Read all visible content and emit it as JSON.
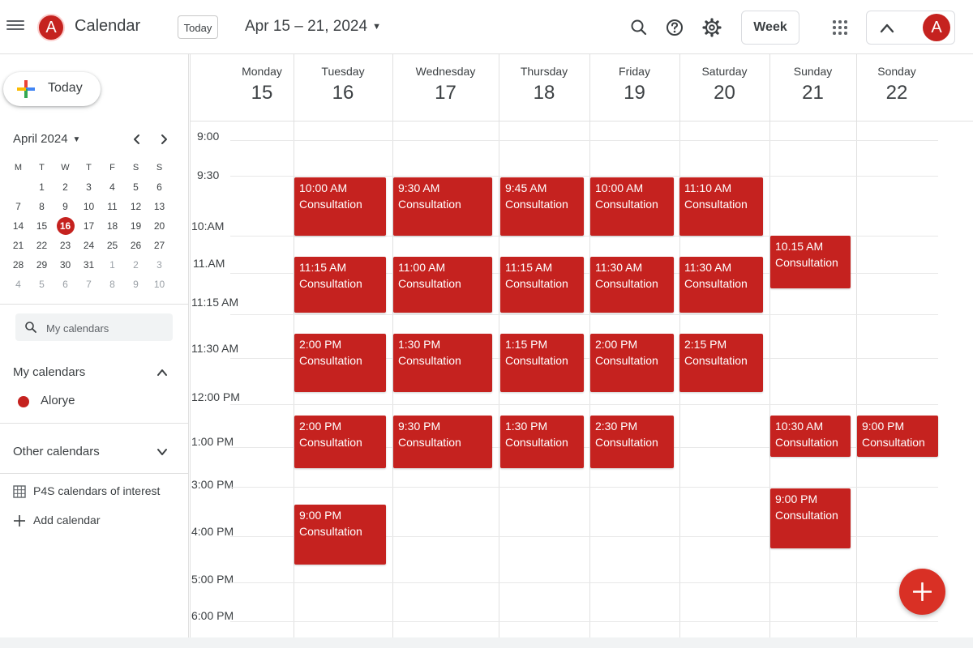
{
  "header": {
    "logo_letter": "A",
    "app_title": "Calendar",
    "today_button": "Today",
    "date_range": "Apr 15 – 21, 2024",
    "view_button": "Week",
    "avatar_letter": "A",
    "icons": [
      "menu-icon",
      "search-icon",
      "help-icon",
      "settings-icon",
      "apps-grid-icon",
      "chevron-up-icon",
      "dropdown-caret-icon"
    ]
  },
  "sidebar": {
    "create_button": "Today",
    "mini_calendar": {
      "month_label": "April 2024",
      "weekdays": [
        "M",
        "T",
        "W",
        "T",
        "F",
        "S",
        "S"
      ],
      "weeks": [
        [
          "",
          "1",
          "2",
          "3",
          "4",
          "5",
          "6"
        ],
        [
          "7",
          "8",
          "9",
          "10",
          "11",
          "12",
          "13"
        ],
        [
          "14",
          "15",
          "16",
          "17",
          "18",
          "19",
          "20"
        ],
        [
          "21",
          "22",
          "23",
          "24",
          "25",
          "26",
          "27"
        ],
        [
          "28",
          "29",
          "30",
          "31",
          "1",
          "2",
          "3"
        ],
        [
          "4",
          "5",
          "6",
          "7",
          "8",
          "9",
          "10"
        ]
      ],
      "selected_day": "16"
    },
    "search_placeholder": "My calendars",
    "my_calendars_title": "My calendars",
    "my_calendars": [
      {
        "label": "Alorye",
        "color": "#c5221f"
      }
    ],
    "other_calendars_title": "Other calendars",
    "other_calendars": [
      {
        "label": "P4S calendars of interest",
        "icon": "grid-calendar-icon"
      },
      {
        "label": "Add calendar",
        "icon": "plus-icon"
      }
    ]
  },
  "days": [
    {
      "name": "Monday",
      "num": "15"
    },
    {
      "name": "Tuesday",
      "num": "16"
    },
    {
      "name": "Wednesday",
      "num": "17"
    },
    {
      "name": "Thursday",
      "num": "18"
    },
    {
      "name": "Friday",
      "num": "19"
    },
    {
      "name": "Saturday",
      "num": "20"
    },
    {
      "name": "Sunday",
      "num": "21"
    },
    {
      "name": "Sonday",
      "num": "22"
    }
  ],
  "time_labels": [
    "9:00",
    "9:30",
    "10:AM",
    "11.AM",
    "11:15 AM",
    "11:30 AM",
    "12:00 PM",
    "1:00 PM",
    "3:00 PM",
    "4:00 PM",
    "5:00 PM",
    "6:00 PM"
  ],
  "events": {
    "title": "Consultation",
    "color": "#c5221f",
    "by_day": [
      [],
      [
        "10:00 AM",
        "11:15 AM",
        "2:00 PM",
        "2:00 PM",
        "9:00 PM"
      ],
      [
        "9:30 AM",
        "11:00 AM",
        "1:30 PM",
        "9:30 PM"
      ],
      [
        "9:45 AM",
        "11:15 AM",
        "1:15 PM",
        "1:30 PM"
      ],
      [
        "10:00 AM",
        "11:30 AM",
        "2:00 PM",
        "2:30 PM"
      ],
      [
        "11:10 AM",
        "11:30 AM",
        "2:15 PM"
      ],
      [
        "10.15 AM",
        "10:30 AM",
        "9:00 PM"
      ],
      [
        "9:00 PM"
      ]
    ]
  },
  "fab_icon": "plus-icon"
}
